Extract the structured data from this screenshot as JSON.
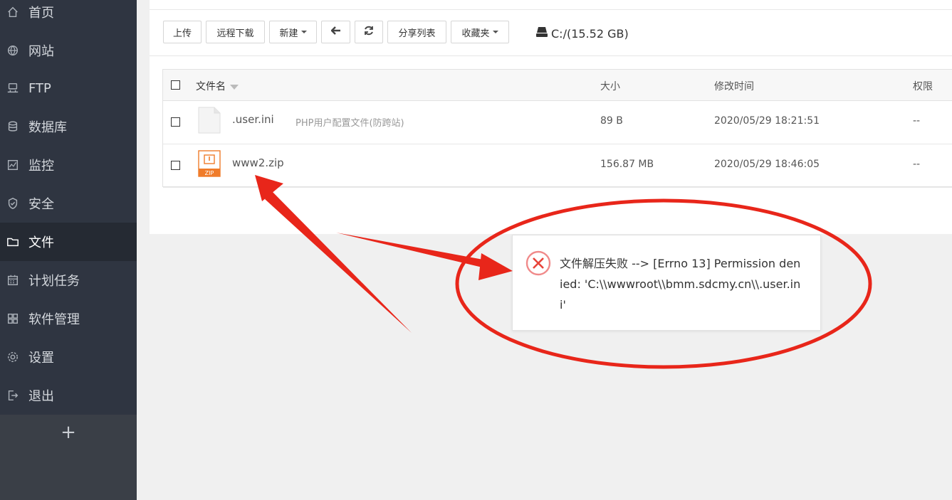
{
  "sidebar": {
    "items": [
      {
        "label": "首页",
        "icon": "home-icon"
      },
      {
        "label": "网站",
        "icon": "globe-icon"
      },
      {
        "label": "FTP",
        "icon": "ftp-icon"
      },
      {
        "label": "数据库",
        "icon": "database-icon"
      },
      {
        "label": "监控",
        "icon": "monitor-icon"
      },
      {
        "label": "安全",
        "icon": "shield-icon"
      },
      {
        "label": "文件",
        "icon": "folder-icon",
        "active": true
      },
      {
        "label": "计划任务",
        "icon": "calendar-icon"
      },
      {
        "label": "软件管理",
        "icon": "apps-icon"
      },
      {
        "label": "设置",
        "icon": "gear-icon"
      },
      {
        "label": "退出",
        "icon": "logout-icon"
      }
    ],
    "add_label": "+"
  },
  "toolbar": {
    "upload": "上传",
    "remote_download": "远程下载",
    "new": "新建",
    "back_icon": "arrow-left-icon",
    "refresh_icon": "refresh-icon",
    "share_list": "分享列表",
    "favorites": "收藏夹",
    "disk": "C:/(15.52 GB)"
  },
  "table": {
    "headers": {
      "name": "文件名",
      "size": "大小",
      "modified": "修改时间",
      "perm": "权限"
    },
    "rows": [
      {
        "name": ".user.ini",
        "desc": "PHP用户配置文件(防跨站)",
        "size": "89 B",
        "modified": "2020/05/29 18:21:51",
        "perm": "--",
        "icon": "file-icon"
      },
      {
        "name": "www2.zip",
        "desc": "",
        "size": "156.87 MB",
        "modified": "2020/05/29 18:46:05",
        "perm": "--",
        "icon": "zip-icon"
      }
    ]
  },
  "toast": {
    "icon": "error-icon",
    "message": "文件解压失败 --> [Errno 13] Permission denied: 'C:\\\\wwwroot\\\\bmm.sdcmy.cn\\\\.user.ini'"
  },
  "colors": {
    "sidebar_bg": "#2f3541",
    "sidebar_active": "#252a33",
    "annotation_red": "#e8261a",
    "zip_orange": "#f07c2a"
  }
}
